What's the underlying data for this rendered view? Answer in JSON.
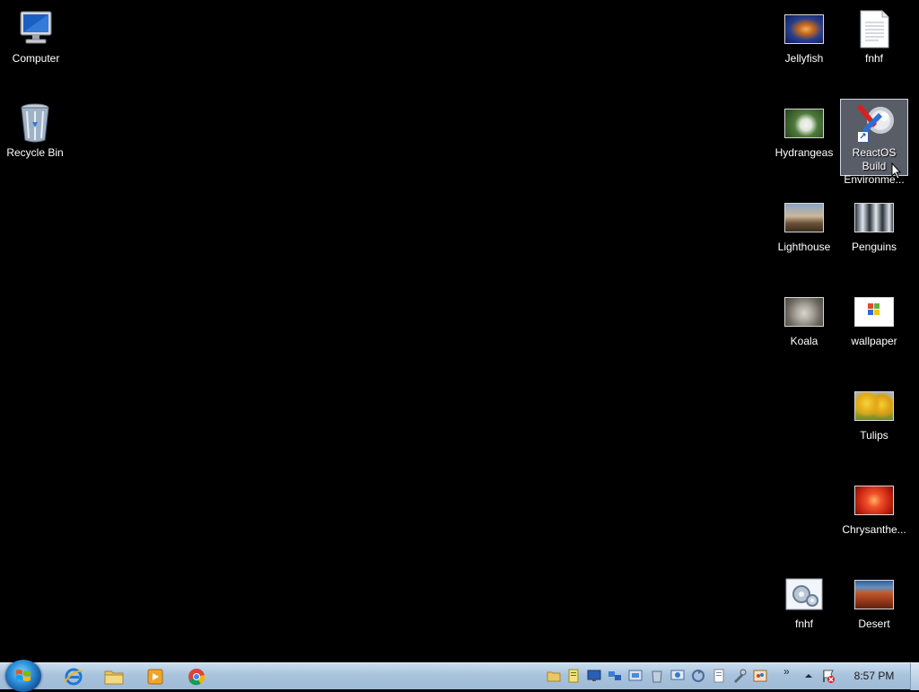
{
  "desktop": {
    "icons": [
      {
        "label": "Computer",
        "icon": "computer-icon"
      },
      {
        "label": "Recycle Bin",
        "icon": "recycle-bin-icon"
      },
      {
        "label": "Jellyfish",
        "icon": "image-thumbnail-jellyfish"
      },
      {
        "label": "fnhf",
        "icon": "text-document-icon"
      },
      {
        "label": "Hydrangeas",
        "icon": "image-thumbnail-hydrangeas"
      },
      {
        "label": "ReactOS Build Environme...",
        "icon": "reactos-build-environment-shortcut-icon"
      },
      {
        "label": "Lighthouse",
        "icon": "image-thumbnail-lighthouse"
      },
      {
        "label": "Penguins",
        "icon": "image-thumbnail-penguins"
      },
      {
        "label": "Koala",
        "icon": "image-thumbnail-koala"
      },
      {
        "label": "wallpaper",
        "icon": "image-thumbnail-wallpaper"
      },
      {
        "label": "Tulips",
        "icon": "image-thumbnail-tulips"
      },
      {
        "label": "Chrysanthe...",
        "icon": "image-thumbnail-chrysanthemum"
      },
      {
        "label": "fnhf",
        "icon": "settings-file-icon"
      },
      {
        "label": "Desert",
        "icon": "image-thumbnail-desert"
      }
    ],
    "selected_icon": "ReactOS Build Environme..."
  },
  "taskbar": {
    "start_icon": "windows-start-orb",
    "pinned": [
      {
        "name": "Internet Explorer",
        "icon": "internet-explorer-icon"
      },
      {
        "name": "Windows Explorer",
        "icon": "folder-explorer-icon"
      },
      {
        "name": "Windows Media Player",
        "icon": "media-player-icon"
      },
      {
        "name": "Google Chrome",
        "icon": "chrome-icon"
      }
    ],
    "tray_icons": [
      "folder-icon",
      "notes-icon",
      "monitor-icon",
      "network-icon",
      "display-icon",
      "bin-icon",
      "remote-icon",
      "sync-icon",
      "document-icon",
      "tool-icon",
      "paint-icon"
    ],
    "overflow": "»",
    "clock": "8:57 PM"
  },
  "colors": {
    "desktop_background": "#000000",
    "taskbar": "#a9c3dd",
    "selection": "#9aa6ba"
  }
}
